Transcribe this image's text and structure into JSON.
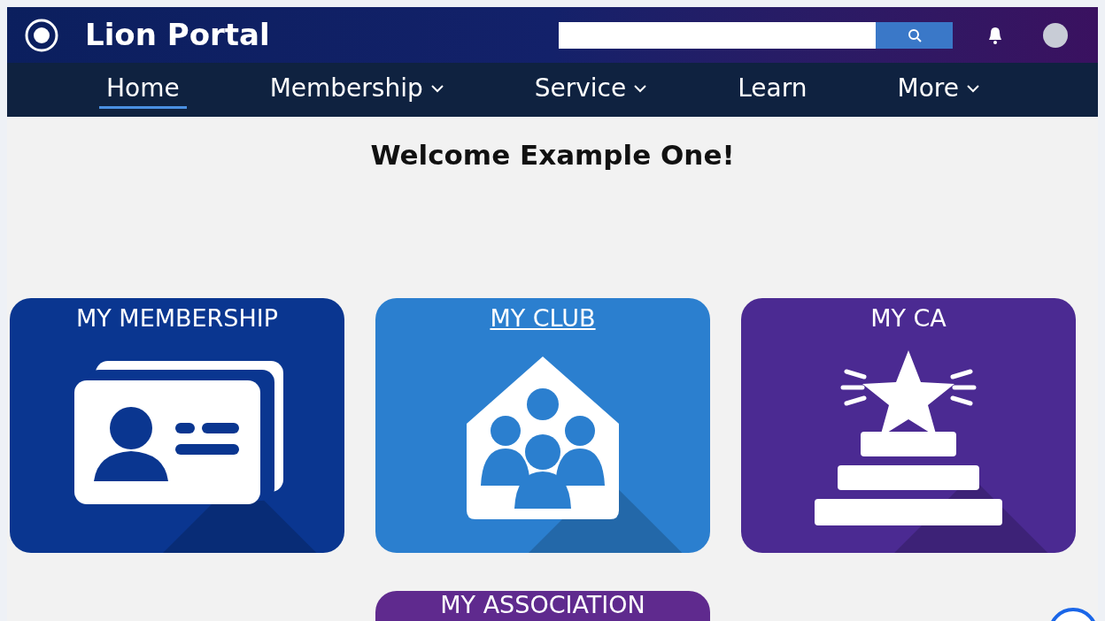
{
  "header": {
    "title": "Lion Portal"
  },
  "nav": [
    {
      "label": "Home",
      "selected": true,
      "dropdown": false
    },
    {
      "label": "Membership",
      "selected": false,
      "dropdown": true
    },
    {
      "label": "Service",
      "selected": false,
      "dropdown": true
    },
    {
      "label": "Learn",
      "selected": false,
      "dropdown": false
    },
    {
      "label": "More",
      "selected": false,
      "dropdown": true
    }
  ],
  "welcome": "Welcome Example One!",
  "tiles": [
    {
      "label": "MY MEMBERSHIP",
      "kind": "card",
      "color": "#0a3690",
      "hovered": false
    },
    {
      "label": "MY CLUB",
      "kind": "club",
      "color": "#2b7fcf",
      "hovered": true
    },
    {
      "label": "MY CA",
      "kind": "award",
      "color": "#4b2a92",
      "hovered": false
    },
    {
      "label": "MY ASSOCIATION",
      "kind": "association",
      "color": "#5f2a8e",
      "hovered": false
    }
  ]
}
